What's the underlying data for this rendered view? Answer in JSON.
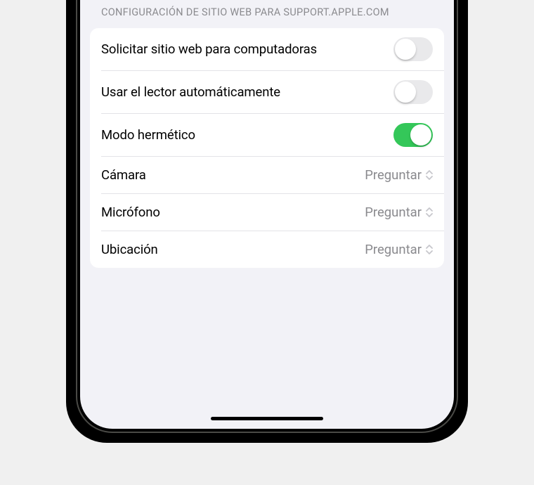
{
  "section_header": "CONFIGURACIÓN DE SITIO WEB PARA SUPPORT.APPLE.COM",
  "rows": [
    {
      "label": "Solicitar sitio web para computadoras",
      "type": "toggle",
      "on": false
    },
    {
      "label": "Usar el lector automáticamente",
      "type": "toggle",
      "on": false
    },
    {
      "label": "Modo hermético",
      "type": "toggle",
      "on": true
    },
    {
      "label": "Cámara",
      "type": "select",
      "value": "Preguntar"
    },
    {
      "label": "Micrófono",
      "type": "select",
      "value": "Preguntar"
    },
    {
      "label": "Ubicación",
      "type": "select",
      "value": "Preguntar"
    }
  ]
}
